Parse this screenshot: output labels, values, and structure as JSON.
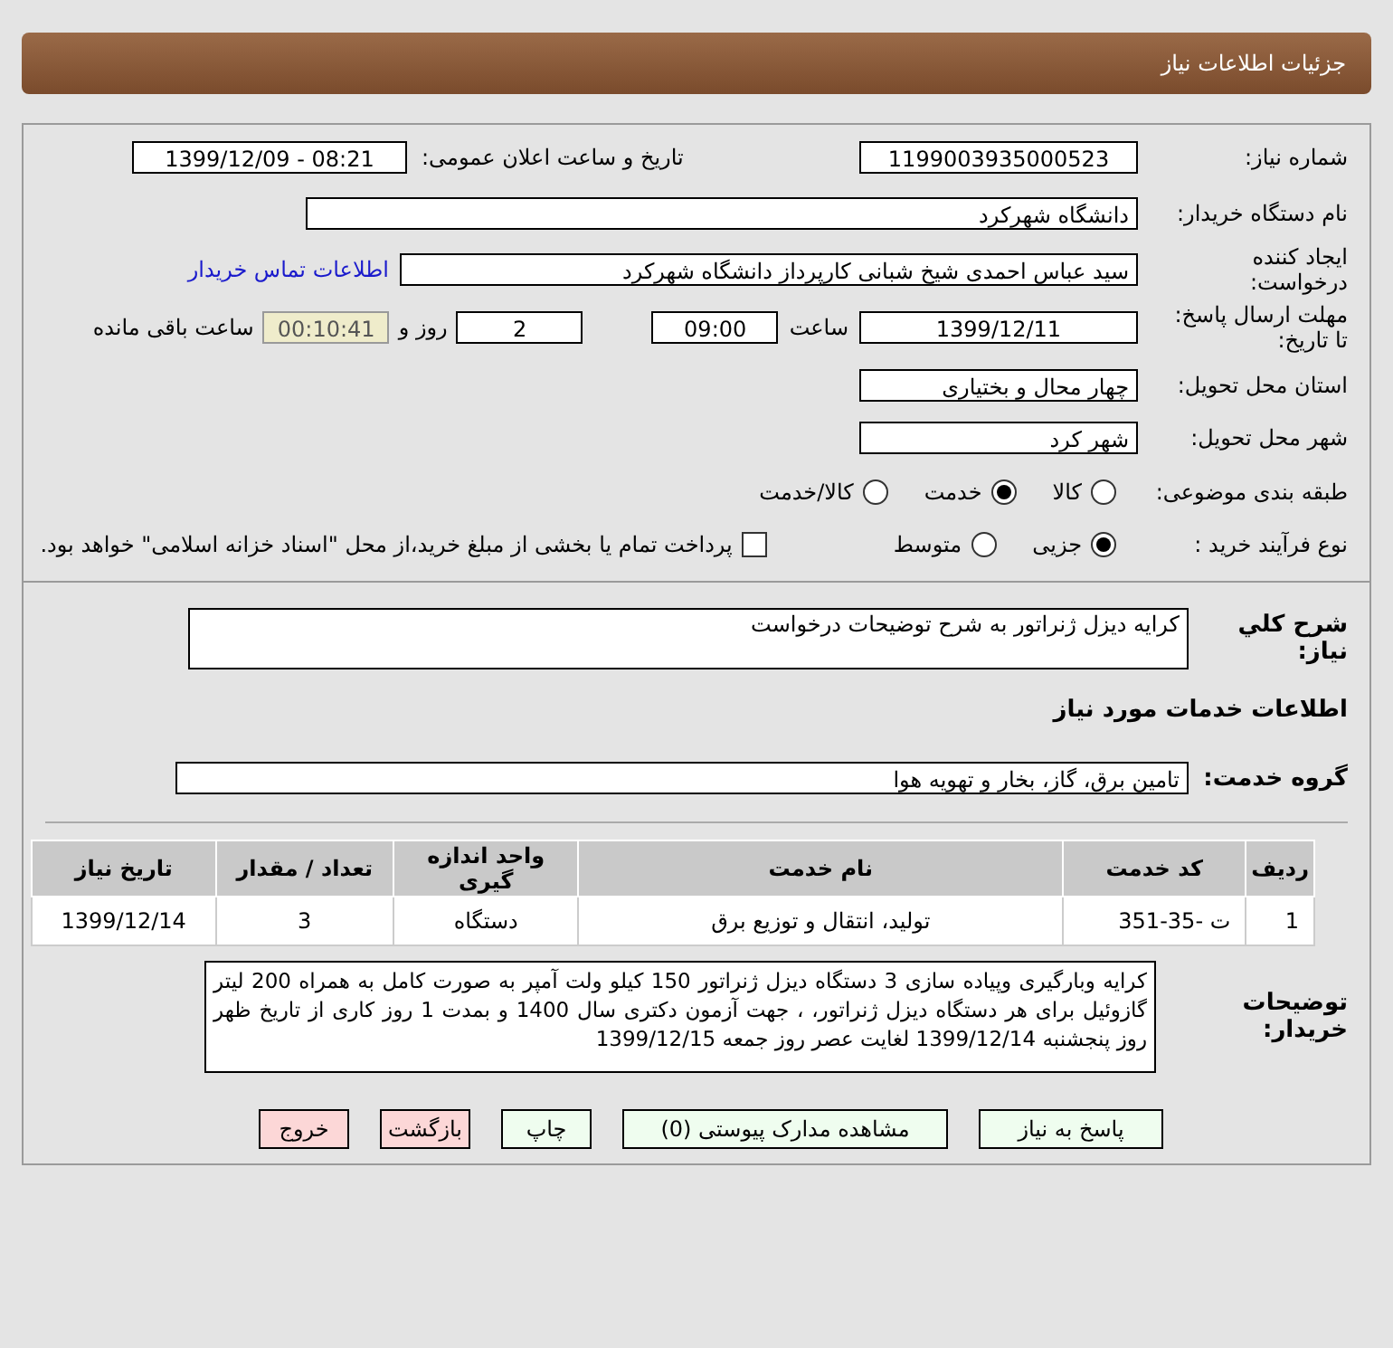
{
  "header": {
    "title": "جزئیات اطلاعات نیاز"
  },
  "need_info": {
    "need_number": {
      "label": "شماره نیاز:",
      "value": "1199003935000523"
    },
    "announce_datetime": {
      "label": "تاریخ و ساعت اعلان عمومی:",
      "value": "1399/12/09 - 08:21"
    },
    "buyer_org": {
      "label": "نام دستگاه خریدار:",
      "value": "دانشگاه شهرکرد"
    },
    "requester": {
      "label": "ایجاد کننده درخواست:",
      "value": "سید عباس احمدی شیخ شبانی کارپرداز دانشگاه شهرکرد",
      "link": "اطلاعات تماس خریدار"
    },
    "deadline": {
      "label": "مهلت ارسال پاسخ: تا تاریخ:",
      "date": "1399/12/11",
      "time_label": "ساعت",
      "time": "09:00",
      "days": "2",
      "days_label": "روز و",
      "remaining": "00:10:41",
      "remaining_label": "ساعت باقی مانده"
    },
    "province": {
      "label": "استان محل تحویل:",
      "value": "چهار محال و بختیاری"
    },
    "city": {
      "label": "شهر محل تحویل:",
      "value": "شهر کرد"
    },
    "category": {
      "label": "طبقه بندی موضوعی:",
      "options": [
        {
          "label": "کالا",
          "selected": false
        },
        {
          "label": "خدمت",
          "selected": true
        },
        {
          "label": "کالا/خدمت",
          "selected": false
        }
      ]
    },
    "purchase_process": {
      "label": "نوع فرآیند خرید :",
      "options": [
        {
          "label": "جزیی",
          "selected": true
        },
        {
          "label": "متوسط",
          "selected": false
        }
      ],
      "treasury_payment": {
        "label": "پرداخت تمام یا بخشی از مبلغ خرید،از محل \"اسناد خزانه اسلامی\" خواهد بود.",
        "checked": false
      }
    }
  },
  "general_description": {
    "label": "شرح کلي نياز:",
    "value": "کرایه دیزل ژنراتور به شرح توضیحات درخواست"
  },
  "services_title": "اطلاعات خدمات مورد نیاز",
  "service_group": {
    "label": "گروه خدمت:",
    "value": "تامین برق، گاز، بخار و تهویه هوا"
  },
  "table": {
    "columns": [
      "ردیف",
      "کد خدمت",
      "نام خدمت",
      "واحد اندازه گیری",
      "تعداد / مقدار",
      "تاریخ نیاز"
    ],
    "rows": [
      [
        "1",
        "ت -35-351",
        "تولید، انتقال و توزیع برق",
        "دستگاه",
        "3",
        "1399/12/14"
      ]
    ]
  },
  "buyer_notes": {
    "label": "توضیحات خریدار:",
    "value": "کرایه وبارگیری وپیاده سازی  3 دستگاه دیزل ژنراتور 150 کیلو ولت آمپر به صورت کامل به همراه 200 لیتر گازوئیل برای هر دستگاه دیزل ژنراتور،  ، جهت آزمون دکتری سال 1400  و بمدت 1 روز کاری از تاریخ ظهر روز پنجشنبه 1399/12/14 لغایت عصر روز جمعه 1399/12/15"
  },
  "buttons": [
    {
      "label": "پاسخ به نیاز",
      "kind": "normal"
    },
    {
      "label": "مشاهده مدارک پیوستی (0)",
      "kind": "normal"
    },
    {
      "label": "چاپ",
      "kind": "normal"
    },
    {
      "label": "بازگشت",
      "kind": "danger"
    },
    {
      "label": "خروج",
      "kind": "danger"
    }
  ]
}
